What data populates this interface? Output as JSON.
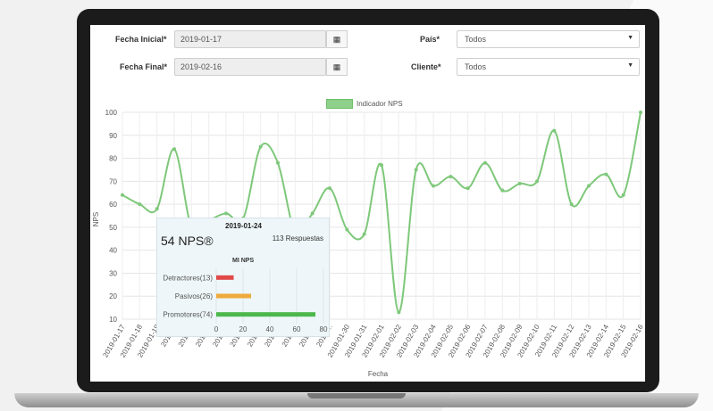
{
  "form": {
    "start_label": "Fecha Inicial*",
    "start_value": "2019-01-17",
    "end_label": "Fecha Final*",
    "end_value": "2019-02-16",
    "country_label": "País*",
    "country_value": "Todos",
    "client_label": "Cliente*",
    "client_value": "Todos",
    "calendar_icon": "calendar-icon"
  },
  "chart_data": {
    "type": "line",
    "legend": "Indicador NPS",
    "xlabel": "Fecha",
    "ylabel": "NPS",
    "ylim": [
      10,
      100
    ],
    "yticks": [
      10,
      20,
      30,
      40,
      50,
      60,
      70,
      80,
      90,
      100
    ],
    "color": "#7ec87a",
    "x": [
      "2019-01-17",
      "2019-01-18",
      "2019-01-19",
      "2019-01-20",
      "2019-01-21",
      "2019-01-22",
      "2019-01-23",
      "2019-01-24",
      "2019-01-25",
      "2019-01-26",
      "2019-01-27",
      "2019-01-28",
      "2019-01-29",
      "2019-01-30",
      "2019-01-31",
      "2019-02-01",
      "2019-02-02",
      "2019-02-03",
      "2019-02-04",
      "2019-02-05",
      "2019-02-06",
      "2019-02-07",
      "2019-02-08",
      "2019-02-09",
      "2019-02-10",
      "2019-02-11",
      "2019-02-12",
      "2019-02-13",
      "2019-02-14",
      "2019-02-15",
      "2019-02-16"
    ],
    "x_tick_labels": [
      "2019-01-17",
      "2019-01-18",
      "2019-01-19",
      "2019-...",
      "2019-...",
      "2019-...",
      "2019-...",
      "2019-...",
      "2019-...",
      "2019-...",
      "2019-...",
      "2019-...",
      "2019-...",
      "2019-01-30",
      "2019-01-31",
      "2019-02-01",
      "2019-02-02",
      "2019-02-03",
      "2019-02-04",
      "2019-02-05",
      "2019-02-06",
      "2019-02-07",
      "2019-02-08",
      "2019-02-09",
      "2019-02-10",
      "2019-02-11",
      "2019-02-12",
      "2019-02-13",
      "2019-02-14",
      "2019-02-15",
      "2019-02-16"
    ],
    "values": [
      64,
      60,
      58,
      84,
      50,
      53,
      56,
      54,
      85,
      78,
      48,
      56,
      67,
      49,
      47,
      77,
      13,
      75,
      68,
      72,
      67,
      78,
      66,
      69,
      70,
      92,
      60,
      68,
      73,
      64,
      100
    ]
  },
  "tooltip": {
    "date": "2019-01-24",
    "score": "54 NPS®",
    "responses": "113 Respuestas",
    "title": "MI NPS",
    "bars": [
      {
        "label": "Detractores(13)",
        "value": 13,
        "color": "#e04848"
      },
      {
        "label": "Pasivos(26)",
        "value": 26,
        "color": "#eeaa3a"
      },
      {
        "label": "Promotores(74)",
        "value": 74,
        "color": "#4cb84c"
      }
    ],
    "xticks": [
      "0",
      "20",
      "40",
      "60",
      "80"
    ],
    "xmax": 80
  }
}
